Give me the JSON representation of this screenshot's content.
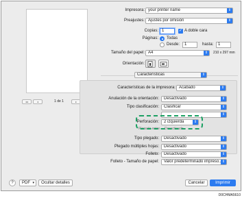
{
  "preview": {
    "page_counter": "1 de 1"
  },
  "printer": {
    "label": "Impresora:",
    "value": "your printer name"
  },
  "presets": {
    "label": "Preajustes:",
    "value": "Ajustes por omisión"
  },
  "copies": {
    "label": "Copias:",
    "value": "1",
    "duplex_label": "A doble cara",
    "duplex_checked": true
  },
  "pages": {
    "label": "Páginas:",
    "all_label": "Todas",
    "from_label": "Desde:",
    "from_value": "1",
    "to_label": "hasta:",
    "to_value": "1"
  },
  "paper_size": {
    "label": "Tamaño del papel:",
    "value": "A4",
    "dimensions": "210 x 297 mm"
  },
  "orientation": {
    "label": "Orientación:"
  },
  "section_menu": {
    "value": "Características"
  },
  "features": {
    "label": "Características de la impresora:",
    "value": "Acabado",
    "rows": [
      {
        "label": "Anulación de la orientación:",
        "value": "Desactivado"
      },
      {
        "label": "Tipo clasificación:",
        "value": "Clasificar"
      },
      {
        "label": "",
        "value": ""
      },
      {
        "label": "Perforación:",
        "value": "2 izquierda"
      },
      {
        "label": "Tipo plegado:",
        "value": "Desactivado"
      },
      {
        "label": "Plegado múltiples hojas:",
        "value": "Desactivado"
      },
      {
        "label": "Folleto:",
        "value": "Desactivado"
      },
      {
        "label": "Folleto - Tamaño de papel:",
        "value": "Valor predeterminado impreso..."
      }
    ],
    "obscured_label": "Plegado entre",
    "obscured_value": "Desactivado"
  },
  "footer": {
    "help": "?",
    "pdf": "PDF",
    "hide_details": "Ocultar detalles",
    "cancel": "Cancelar",
    "print": "Imprimir"
  },
  "figure_code": "D0CHMA5610"
}
